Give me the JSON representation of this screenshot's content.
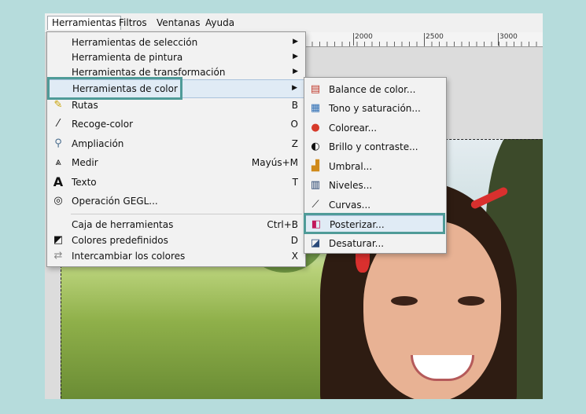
{
  "menubar": [
    "Herramientas",
    "Filtros",
    "Ventanas",
    "Ayuda"
  ],
  "ruler": {
    "ticks": [
      "2000",
      "2500",
      "3000"
    ]
  },
  "main_menu": {
    "items": [
      {
        "label": "Herramientas de selección",
        "submenu": true,
        "icon": ""
      },
      {
        "label": "Herramienta de pintura",
        "submenu": true,
        "icon": ""
      },
      {
        "label": "Herramientas de transformación",
        "submenu": true,
        "icon": ""
      },
      {
        "label": "Herramientas de color",
        "submenu": true,
        "icon": "",
        "highlighted": true
      },
      {
        "label": "Rutas",
        "accel": "B",
        "icon": "paths-icon"
      },
      {
        "label": "Recoge-color",
        "accel": "O",
        "icon": "color-picker-icon"
      },
      {
        "label": "Ampliación",
        "accel": "Z",
        "icon": "zoom-icon"
      },
      {
        "label": "Medir",
        "accel": "Mayús+M",
        "icon": "measure-icon"
      },
      {
        "label": "Texto",
        "accel": "T",
        "icon": "text-icon"
      },
      {
        "label": "Operación GEGL...",
        "icon": "gegl-icon"
      },
      {
        "label": "Caja de herramientas",
        "accel": "Ctrl+B",
        "icon": ""
      },
      {
        "label": "Colores predefinidos",
        "accel": "D",
        "icon": "default-colors-icon"
      },
      {
        "label": "Intercambiar los colores",
        "accel": "X",
        "icon": "swap-colors-icon"
      }
    ]
  },
  "color_submenu": {
    "items": [
      {
        "label": "Balance de color...",
        "icon": "color-balance-icon"
      },
      {
        "label": "Tono y saturación...",
        "icon": "hue-saturation-icon"
      },
      {
        "label": "Colorear...",
        "icon": "colorize-icon"
      },
      {
        "label": "Brillo y contraste...",
        "icon": "brightness-contrast-icon"
      },
      {
        "label": "Umbral...",
        "icon": "threshold-icon"
      },
      {
        "label": "Niveles...",
        "icon": "levels-icon"
      },
      {
        "label": "Curvas...",
        "icon": "curves-icon"
      },
      {
        "label": "Posterizar...",
        "icon": "posterize-icon",
        "highlighted": true
      },
      {
        "label": "Desaturar...",
        "icon": "desaturate-icon"
      }
    ]
  },
  "colors": {
    "highlight_frame": "#4f9b98",
    "accent_teal": "#b6dcdc"
  }
}
